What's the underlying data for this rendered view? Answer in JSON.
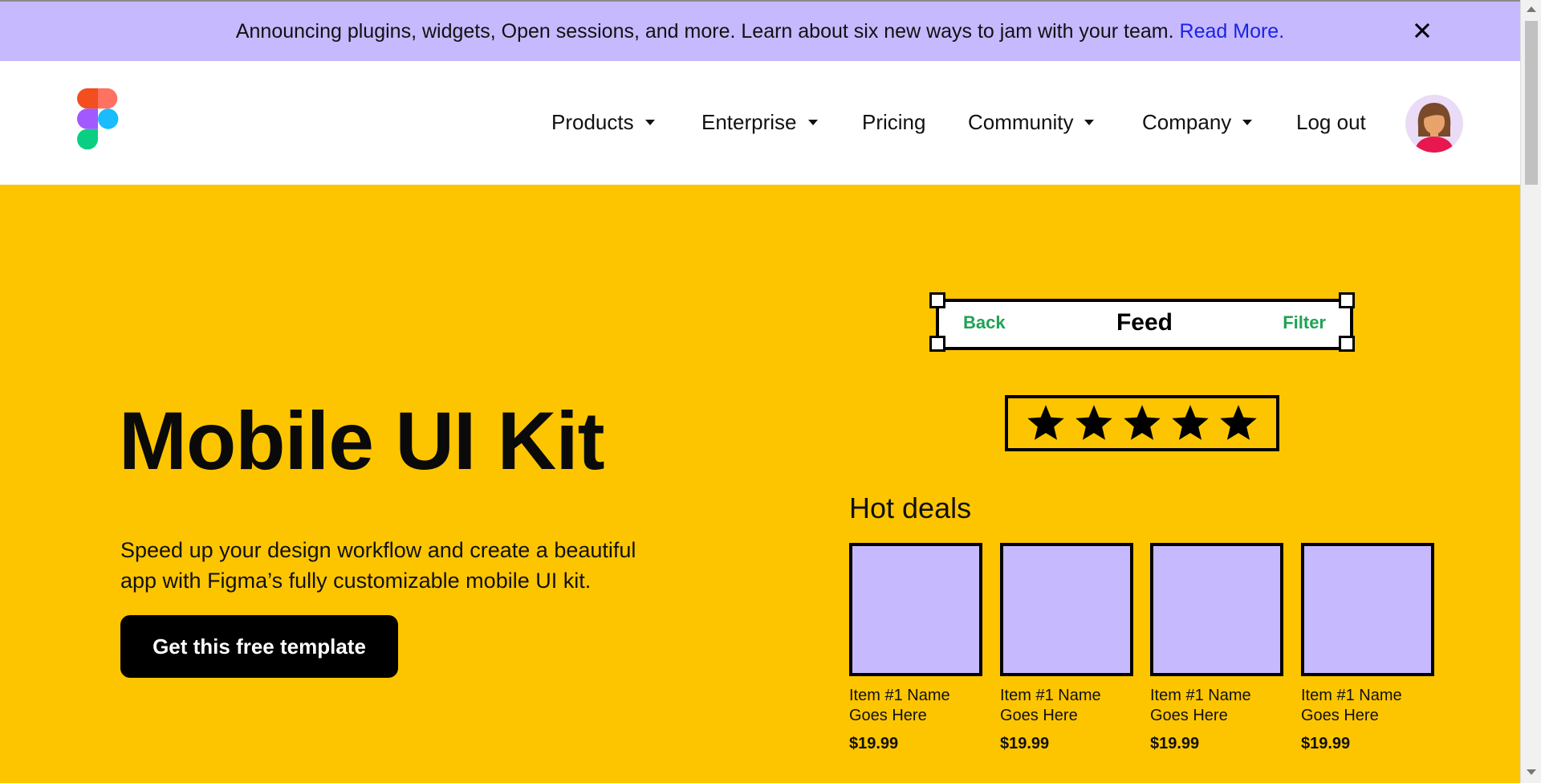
{
  "banner": {
    "text": "Announcing plugins, widgets, Open sessions, and more. Learn about six new ways to jam with your team.",
    "link": "Read More.",
    "bg_color": "#c6b9fe",
    "link_color": "#1a23e6"
  },
  "nav": {
    "logo": "figma-logo-icon",
    "items": [
      {
        "label": "Products",
        "has_dropdown": true
      },
      {
        "label": "Enterprise",
        "has_dropdown": true
      },
      {
        "label": "Pricing",
        "has_dropdown": false
      },
      {
        "label": "Community",
        "has_dropdown": true
      },
      {
        "label": "Company",
        "has_dropdown": true
      },
      {
        "label": "Log out",
        "has_dropdown": false
      }
    ],
    "avatar": "user-avatar-icon"
  },
  "hero": {
    "bg_color": "#fdc500",
    "title": "Mobile UI Kit",
    "description": "Speed up your design workflow and create a beautiful app with Figma’s fully customizable mobile UI kit.",
    "cta": "Get this free template"
  },
  "preview": {
    "feedbar": {
      "back": "Back",
      "title": "Feed",
      "filter": "Filter"
    },
    "rating": 5,
    "section_title": "Hot deals",
    "cards": [
      {
        "name": "Item #1 Name Goes Here",
        "price": "$19.99"
      },
      {
        "name": "Item #1 Name Goes Here",
        "price": "$19.99"
      },
      {
        "name": "Item #1 Name Goes Here",
        "price": "$19.99"
      },
      {
        "name": "Item #1 Name Goes Here",
        "price": "$19.99"
      }
    ],
    "accent_green": "#1ea354",
    "card_color": "#c6b9fe"
  }
}
